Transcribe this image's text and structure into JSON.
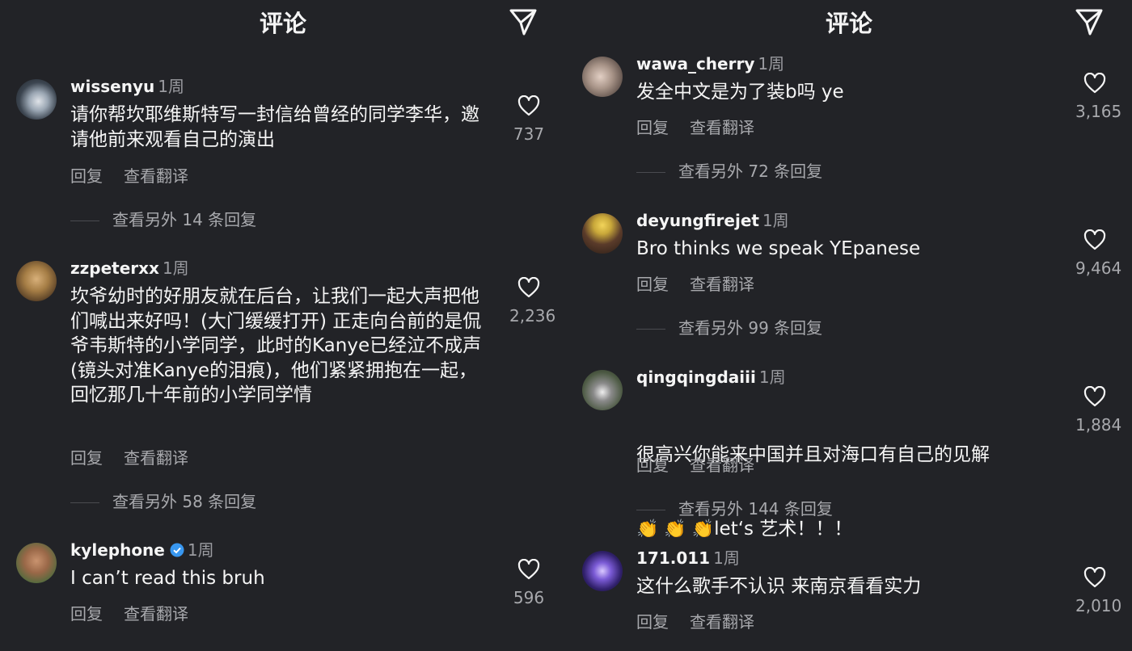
{
  "panels": [
    {
      "title": "评论",
      "comments": [
        {
          "user": "wissenyu",
          "verified": false,
          "time": "1周",
          "text": "请你帮坎耶维斯特写一封信给曾经的同学李华，邀请他前来观看自己的演出",
          "reply": "回复",
          "translate": "查看翻译",
          "more_replies": "查看另外 14 条回复",
          "likes": "737"
        },
        {
          "user": "zzpeterxx",
          "verified": false,
          "time": "1周",
          "text": "坎爷幼时的好朋友就在后台，让我们一起大声把他们喊出来好吗！(大门缓缓打开) 正走向台前的是侃爷韦斯特的小学同学，此时的Kanye已经泣不成声 (镜头对准Kanye的泪痕)，他们紧紧拥抱在一起，回忆那几十年前的小学同学情",
          "reply": "回复",
          "translate": "查看翻译",
          "more_replies": "查看另外 58 条回复",
          "likes": "2,236"
        },
        {
          "user": "kylephone",
          "verified": true,
          "time": "1周",
          "text": "I can’t read this bruh",
          "reply": "回复",
          "translate": "查看翻译",
          "more_replies": "",
          "likes": "596"
        }
      ]
    },
    {
      "title": "评论",
      "comments": [
        {
          "user": "wawa_cherry",
          "verified": false,
          "time": "1周",
          "text": "发全中文是为了装b吗 ye",
          "reply": "回复",
          "translate": "查看翻译",
          "more_replies": "查看另外 72 条回复",
          "likes": "3,165"
        },
        {
          "user": "deyungfirejet",
          "verified": false,
          "time": "1周",
          "text": "Bro thinks we speak YEpanese",
          "reply": "回复",
          "translate": "查看翻译",
          "more_replies": "查看另外 99 条回复",
          "likes": "9,464"
        },
        {
          "user": "qingqingdaiii",
          "verified": false,
          "time": "1周",
          "text": "很高兴你能来中国并且对海口有自己的见解",
          "text_line2": "let‘s 艺术！！！",
          "reply": "回复",
          "translate": "查看翻译",
          "more_replies": "查看另外 144 条回复",
          "likes": "1,884"
        },
        {
          "user": "171.011",
          "verified": false,
          "time": "1周",
          "text": "这什么歌手不认识 来南京看看实力",
          "reply": "回复",
          "translate": "查看翻译",
          "more_replies": "",
          "likes": "2,010"
        }
      ]
    }
  ],
  "icons": {
    "send": "send-paper-plane-icon",
    "like": "heart-outline-icon",
    "verified": "verified-badge-icon",
    "clap": "clapping-hands-emoji"
  },
  "colors": {
    "background": "#222327",
    "text": "#f5f5f5",
    "muted": "#a8a9ad",
    "verified": "#3897f0"
  }
}
